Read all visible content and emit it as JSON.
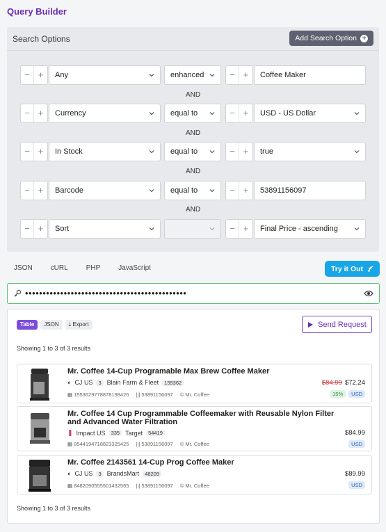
{
  "app_title": "Query Builder",
  "search_options": {
    "title": "Search Options",
    "add_button": "Add Search Option",
    "join_word": "AND",
    "rows": [
      {
        "field": "Any",
        "operator": "enhanced",
        "value": "Coffee Maker",
        "value_has_dropdown": false
      },
      {
        "field": "Currency",
        "operator": "equal to",
        "value": "USD - US Dollar",
        "value_has_dropdown": true
      },
      {
        "field": "In Stock",
        "operator": "equal to",
        "value": "true",
        "value_has_dropdown": true
      },
      {
        "field": "Barcode",
        "operator": "equal to",
        "value": "53891156097",
        "value_has_dropdown": false
      },
      {
        "field": "Sort",
        "operator": "",
        "value": "Final Price - ascending",
        "value_has_dropdown": true
      }
    ]
  },
  "code_tabs": [
    "JSON",
    "cURL",
    "PHP",
    "JavaScript"
  ],
  "try_button": "Try it Out",
  "api_key_masked": "••••••••••••••••••••••••••••••••••••••••••••••",
  "results": {
    "view_tabs": [
      "Table",
      "JSON",
      "Export"
    ],
    "send_button": "Send Request",
    "showing_top": "Showing 1 to 3 of 3 results",
    "showing_bottom": "Showing 1 to 3 of 3 results",
    "items": [
      {
        "title": "Mr. Coffee 14-Cup Programable Max Brew Coffee Maker",
        "network": "CJ US",
        "network_count": "3",
        "store": "Blain Farm & Fleet",
        "store_id": "155362",
        "code1": "1553629778878198426",
        "barcode": "53891156097",
        "brand": "Mr. Coffee",
        "old_price": "$84.99",
        "price": "$72.24",
        "discount": "15%",
        "currency": "USD"
      },
      {
        "title": "Mr. Coffee 14 Cup Programmable Coffeemaker with Reusable Nylon Filter and Advanced Water Filtration",
        "network": "Impact US",
        "network_count": "335",
        "store": "Target",
        "store_id": "54419",
        "code1": "8544194718823325425",
        "barcode": "53891156097",
        "brand": "Mr. Coffee",
        "old_price": "",
        "price": "$84.99",
        "discount": "",
        "currency": "USD"
      },
      {
        "title": "Mr. Coffee 2143561 14-Cup Prog Coffee Maker",
        "network": "CJ US",
        "network_count": "3",
        "store": "BrandsMart",
        "store_id": "48209",
        "code1": "8482090555501432565",
        "barcode": "53891156097",
        "brand": "Mr. Coffee",
        "old_price": "",
        "price": "$89.99",
        "discount": "",
        "currency": "USD"
      }
    ]
  },
  "colors": {
    "accent": "#6b2fb3",
    "try_button": "#19a6e6",
    "key_border": "#5cc17a"
  }
}
